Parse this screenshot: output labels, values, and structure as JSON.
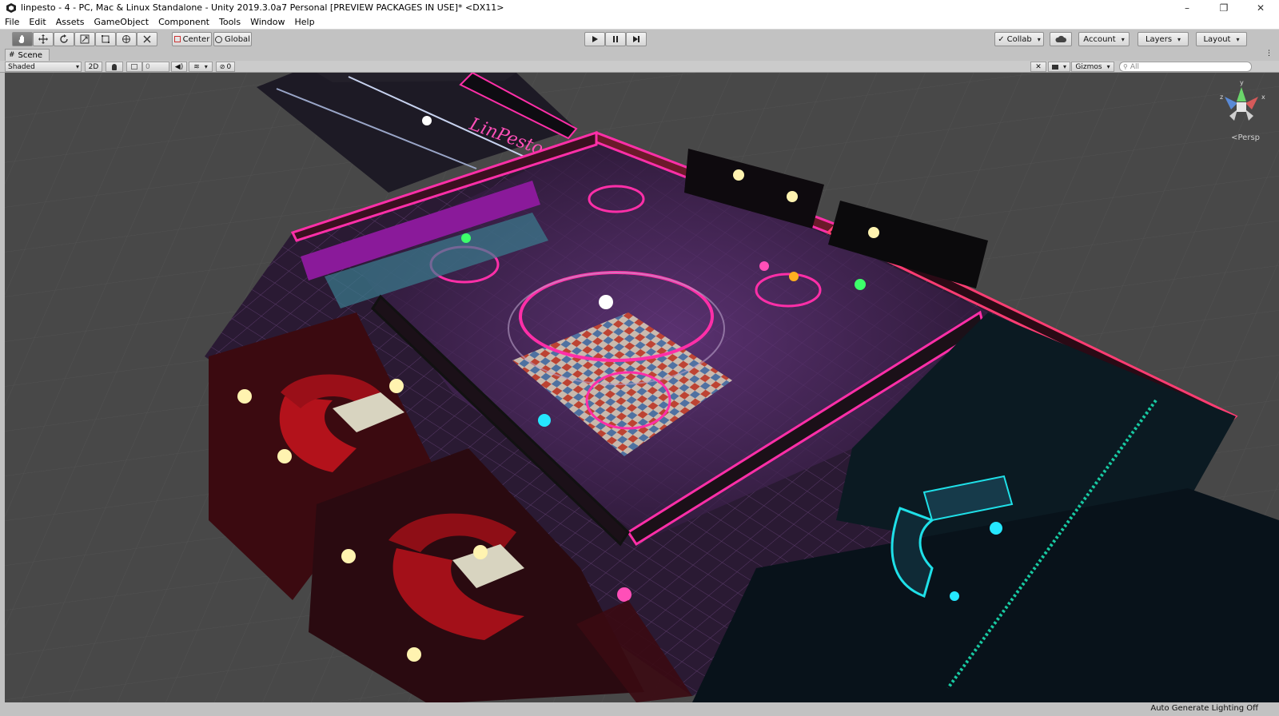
{
  "window": {
    "title": "linpesto - 4 - PC, Mac & Linux Standalone - Unity 2019.3.0a7 Personal [PREVIEW PACKAGES IN USE]* <DX11>",
    "app_icon": "unity-icon",
    "controls": {
      "minimize": "–",
      "maximize": "❐",
      "close": "✕"
    }
  },
  "menu": [
    "File",
    "Edit",
    "Assets",
    "GameObject",
    "Component",
    "Tools",
    "Window",
    "Help"
  ],
  "toolbar": {
    "tools": [
      "hand-tool-icon",
      "move-tool-icon",
      "rotate-tool-icon",
      "scale-tool-icon",
      "rect-tool-icon",
      "transform-tool-icon",
      "custom-tool-icon"
    ],
    "pivot_mode": "Center",
    "pivot_rotation": "Global",
    "play_controls": [
      "play-icon",
      "pause-icon",
      "step-icon"
    ],
    "collab": "Collab",
    "account": "Account",
    "layers": "Layers",
    "layout": "Layout"
  },
  "scene_tab": {
    "label": "Scene"
  },
  "scene_toolbar": {
    "draw_mode": "Shaded",
    "mode_2d": "2D",
    "light_toggle": "lightbulb-icon",
    "fx_value": "0",
    "audio_toggle": "speaker-icon",
    "effects_toggle": "effects-icon",
    "hidden_count": "0",
    "gizmos": "Gizmos",
    "search_placeholder": "All"
  },
  "viewport": {
    "projection": "Persp",
    "gizmo_axes": {
      "y": "y",
      "z": "z",
      "x": "x"
    },
    "neon_sign": "LinPesto"
  },
  "status": {
    "lighting": "Auto Generate Lighting Off"
  },
  "colors": {
    "neon_pink": "#ff2fa8",
    "neon_cyan": "#1fe0e8",
    "grid_bg": "#484848",
    "chrome": "#c2c2c2"
  }
}
